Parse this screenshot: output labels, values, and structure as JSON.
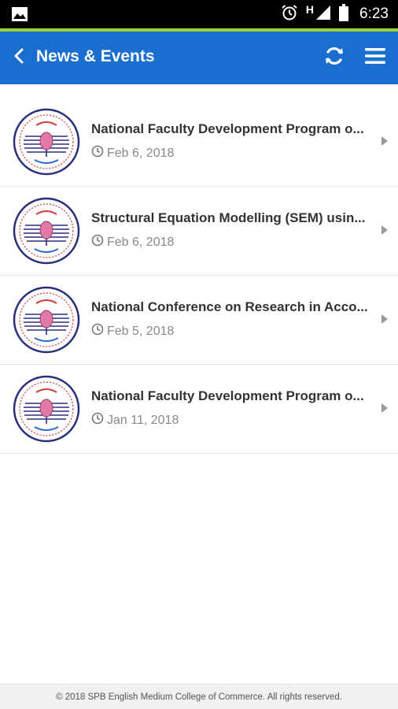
{
  "status_bar": {
    "time": "6:23",
    "network_indicator": "H",
    "icons": [
      "image-icon",
      "alarm-icon",
      "signal-icon",
      "battery-icon"
    ]
  },
  "app_bar": {
    "title": "News & Events",
    "background_color": "#1a6ed0",
    "accent_color": "#9bd12c",
    "icons": [
      "back-icon",
      "refresh-icon",
      "menu-icon"
    ]
  },
  "news": {
    "items": [
      {
        "title": "National Faculty Development Program o...",
        "date": "Feb 6, 2018"
      },
      {
        "title": "Structural Equation Modelling (SEM) usin...",
        "date": "Feb 6, 2018"
      },
      {
        "title": "National Conference on Research in Acco...",
        "date": "Feb 5, 2018"
      },
      {
        "title": "National Faculty Development Program o...",
        "date": "Jan 11, 2018"
      }
    ]
  },
  "footer": {
    "text": "© 2018 SPB English Medium College of Commerce. All rights reserved."
  }
}
